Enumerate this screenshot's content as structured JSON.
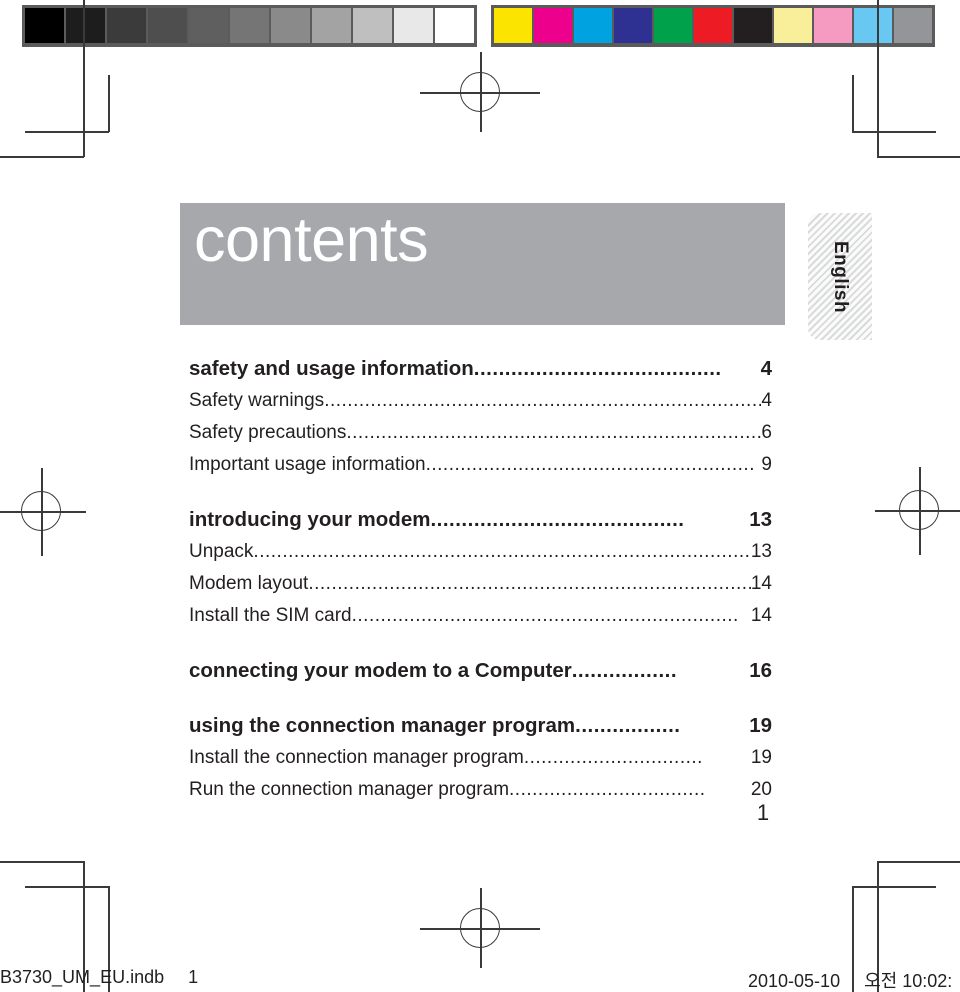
{
  "document": {
    "banner_title": "contents",
    "language_tab": "English",
    "page_number": "1"
  },
  "color_bar": {
    "grayscale": [
      "#000000",
      "#1d1d1d",
      "#3b3b3b",
      "#4e4e4e",
      "#5f5f5f",
      "#757575",
      "#8a8a8a",
      "#a3a3a3",
      "#bfbfbf",
      "#e8e8e8",
      "#ffffff"
    ],
    "colors": [
      "#fbe400",
      "#ec008c",
      "#00a3e0",
      "#2e3192",
      "#00a14b",
      "#ed1c24",
      "#231f20",
      "#f9ef9a",
      "#f59bc1",
      "#69c8f2",
      "#939598"
    ]
  },
  "toc": {
    "groups": [
      {
        "heading": {
          "label": "safety and usage information",
          "page": "4",
          "leader": "........................................"
        },
        "items": [
          {
            "label": "Safety warnings",
            "page": "4",
            "leader": "............................................................................"
          },
          {
            "label": "Safety precautions ",
            "page": "6",
            "leader": "........................................................................."
          },
          {
            "label": "Important usage information ",
            "page": "9",
            "leader": "........................................................."
          }
        ]
      },
      {
        "heading": {
          "label": "introducing your modem ",
          "page": "13",
          "leader": "........................................."
        },
        "items": [
          {
            "label": "Unpack",
            "page": "13",
            "leader": "..........................................................................................."
          },
          {
            "label": "Modem layout",
            "page": "14",
            "leader": "............................................................................."
          },
          {
            "label": "Install the SIM card ",
            "page": "14",
            "leader": "..................................................................."
          }
        ]
      },
      {
        "heading": {
          "label": "connecting your modem to a Computer ",
          "page": "16",
          "leader": "................."
        },
        "items": []
      },
      {
        "heading": {
          "label": "using the connection manager program",
          "page": "19",
          "leader": "................."
        },
        "items": [
          {
            "label": "Install the connection manager program ",
            "page": "19",
            "leader": "..............................."
          },
          {
            "label": "Run the connection manager program",
            "page": "20",
            "leader": ".................................."
          }
        ]
      }
    ]
  },
  "footer": {
    "file_name": "B3730_UM_EU.indb",
    "file_page": "1",
    "date": "2010-05-10",
    "time": "오전 10:02:"
  }
}
